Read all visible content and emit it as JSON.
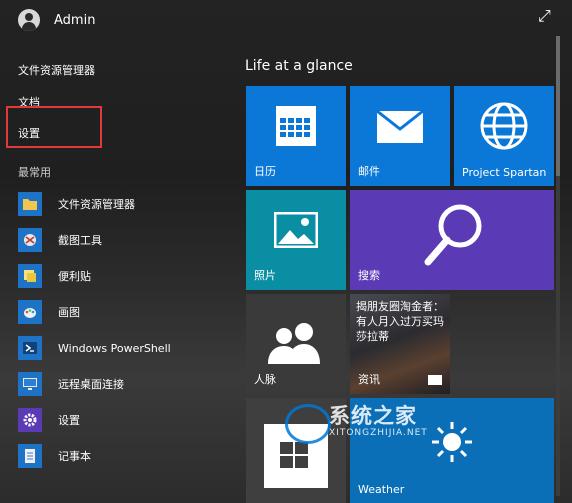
{
  "user": {
    "name": "Admin"
  },
  "places": {
    "file_explorer": "文件资源管理器",
    "documents": "文档",
    "settings": "设置"
  },
  "most_used": {
    "title": "最常用",
    "items": [
      {
        "label": "文件资源管理器",
        "icon": "folder-icon",
        "color": "#1e73c6"
      },
      {
        "label": "截图工具",
        "icon": "scissors-icon",
        "color": "#1e73c6"
      },
      {
        "label": "便利贴",
        "icon": "sticky-note-icon",
        "color": "#1e73c6"
      },
      {
        "label": "画图",
        "icon": "paint-palette-icon",
        "color": "#1e73c6"
      },
      {
        "label": "Windows PowerShell",
        "icon": "powershell-icon",
        "color": "#1e73c6"
      },
      {
        "label": "远程桌面连接",
        "icon": "remote-desktop-icon",
        "color": "#1e73c6"
      },
      {
        "label": "设置",
        "icon": "gear-icon",
        "color": "#5b3ab6"
      },
      {
        "label": "记事本",
        "icon": "notepad-icon",
        "color": "#1e73c6"
      }
    ]
  },
  "group_title": "Life at a glance",
  "tiles": {
    "calendar": {
      "label": "日历",
      "color": "#0b78d7"
    },
    "mail": {
      "label": "邮件",
      "color": "#0b78d7"
    },
    "spartan": {
      "label": "Project Spartan",
      "color": "#0b78d7"
    },
    "photos": {
      "label": "照片",
      "color": "#0a8ea3"
    },
    "search": {
      "label": "搜索",
      "color": "#5b3ab6"
    },
    "people": {
      "label": "人脉",
      "color": "#3a3a3a"
    },
    "news": {
      "label": "资讯",
      "headline": "揭朋友圈淘金者：有人月入过万买玛莎拉蒂",
      "color": "#2a2a2a"
    },
    "store": {
      "label": "",
      "color": "#3f3f3f"
    },
    "weather": {
      "label": "Weather",
      "color": "#0b6fb8"
    }
  },
  "watermark": {
    "title": "系统之家",
    "url": "XITONGZHIJIA.NET"
  }
}
